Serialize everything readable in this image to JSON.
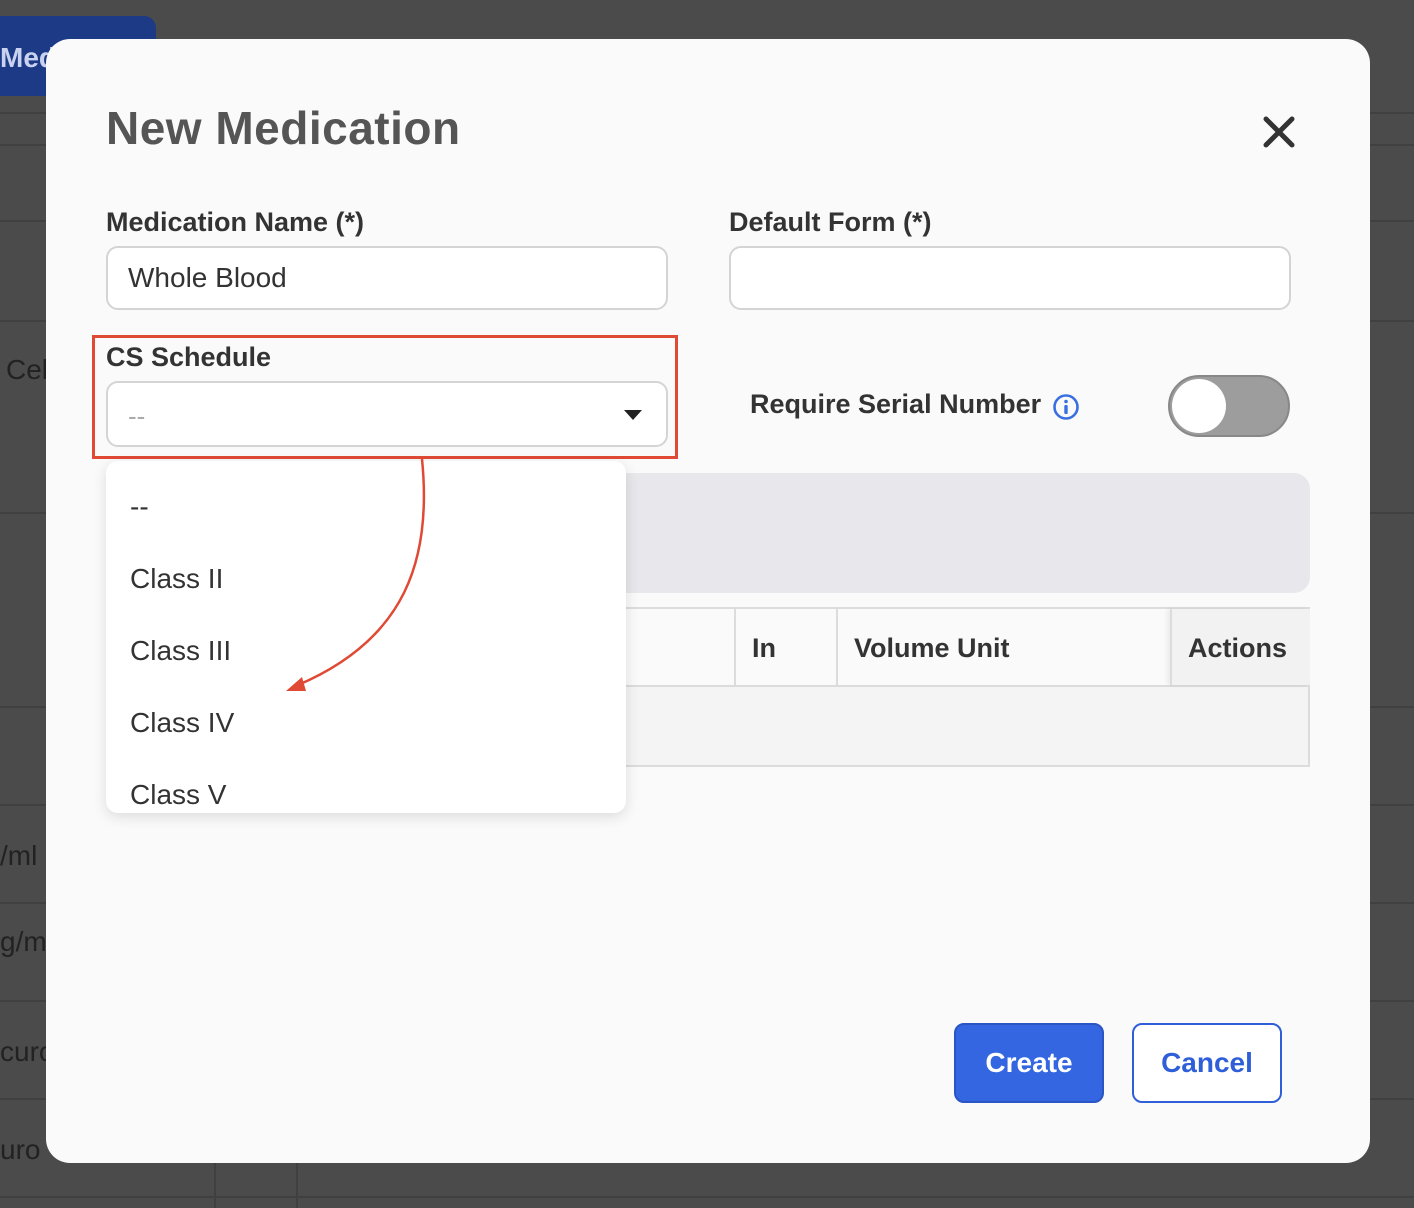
{
  "background": {
    "top_button_label": "Medi",
    "fragments": [
      "Cel",
      "/ml (",
      "g/m",
      "curo",
      "uro"
    ]
  },
  "modal": {
    "title": "New Medication",
    "close_icon": "close-icon",
    "medication_name": {
      "label": "Medication Name (*)",
      "value": "Whole Blood"
    },
    "default_form": {
      "label": "Default Form (*)",
      "value": ""
    },
    "cs_schedule": {
      "label": "CS Schedule",
      "selected": "--",
      "options": [
        "--",
        "Class II",
        "Class III",
        "Class IV",
        "Class V"
      ]
    },
    "require_serial": {
      "label": "Require Serial Number",
      "info_icon": "info-icon",
      "enabled": false
    },
    "table": {
      "columns": [
        "In",
        "Volume Unit",
        "Actions"
      ]
    },
    "buttons": {
      "create": "Create",
      "cancel": "Cancel"
    }
  },
  "colors": {
    "primary": "#3366e0",
    "highlight": "#e04a34",
    "toggle_off": "#9d9d9d"
  }
}
